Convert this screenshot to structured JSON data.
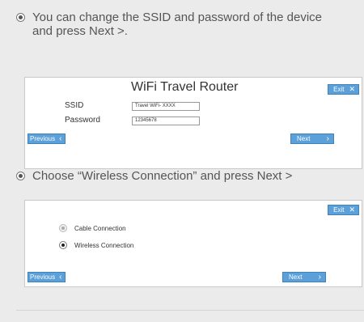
{
  "step1": {
    "instruction": "You can change the SSID and password of the device and press Next >.",
    "dialog": {
      "exit_label": "Exit",
      "title": "WiFi Travel Router",
      "ssid_label": "SSID",
      "ssid_value": "Travel WiFi- XXXX",
      "password_label": "Password",
      "password_value": "12345678",
      "previous_label": "Previous",
      "next_label": "Next"
    }
  },
  "step2": {
    "instruction": "Choose “Wireless Connection” and press Next >",
    "dialog": {
      "exit_label": "Exit",
      "options": [
        {
          "label": "Cable Connection",
          "selected": false
        },
        {
          "label": "Wireless Connection",
          "selected": true
        }
      ],
      "previous_label": "Previous",
      "next_label": "Next"
    }
  },
  "icons": {
    "bullet": "radio-bullet-icon",
    "close": "close-x-icon",
    "prev": "chevron-left-icon",
    "next": "chevron-right-icon"
  },
  "colors": {
    "button_blue": "#5ba0d9",
    "page_bg": "#ebebeb",
    "panel_bg": "#ffffff"
  }
}
